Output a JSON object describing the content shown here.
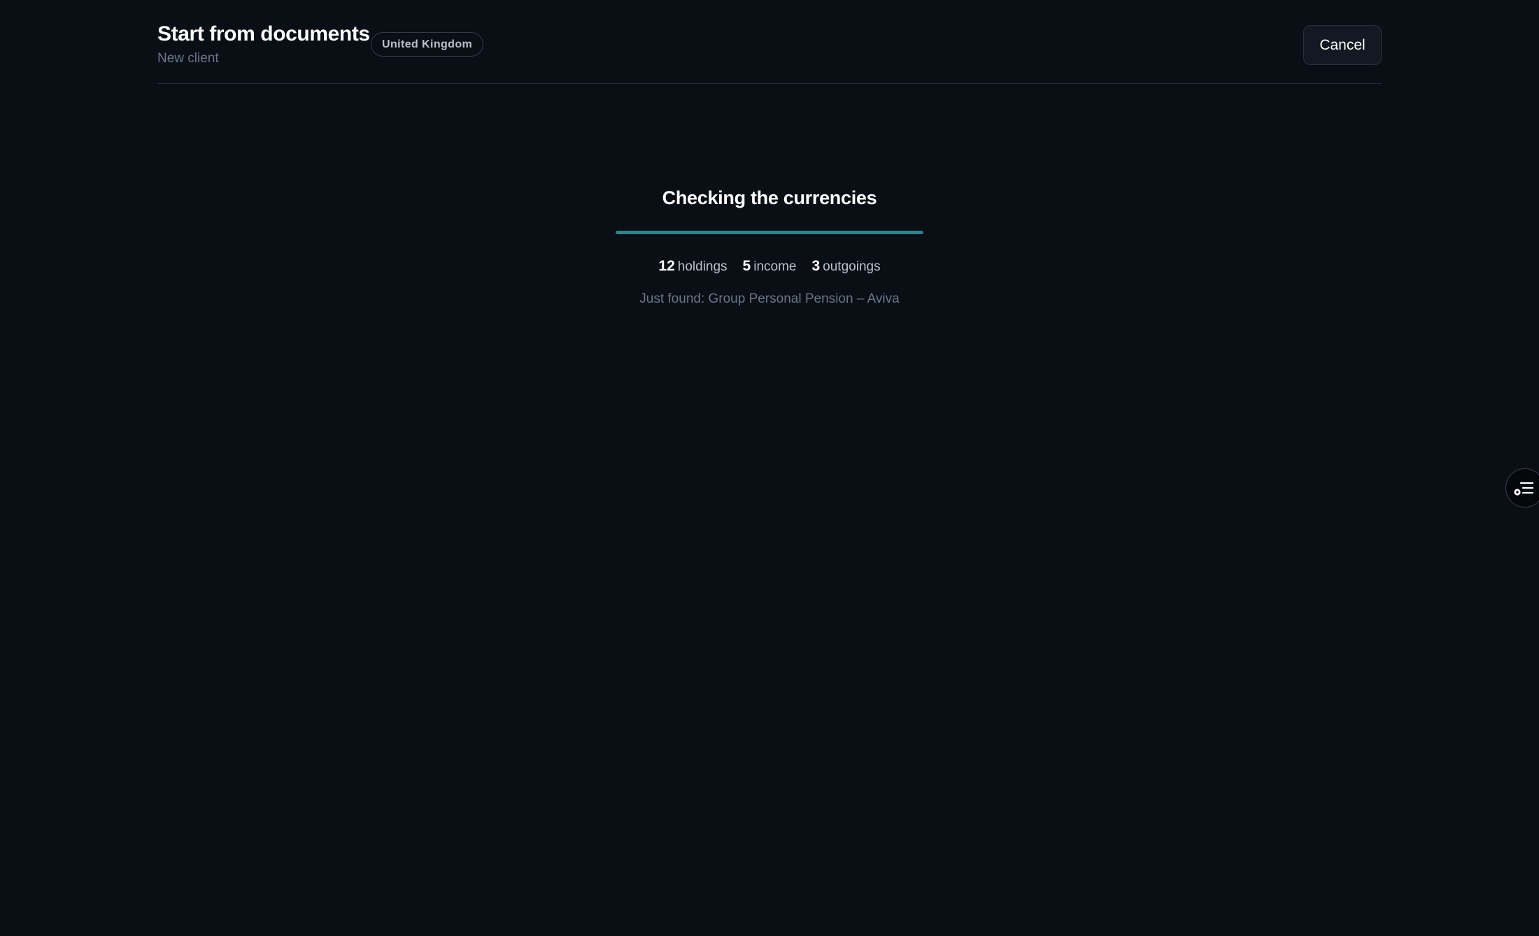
{
  "header": {
    "title": "Start from documents",
    "subtitle": "New client",
    "country_badge": "United Kingdom",
    "cancel_label": "Cancel"
  },
  "progress": {
    "status_title": "Checking the currencies",
    "fraction_complete": 1.0,
    "bar_color": "#2e8488",
    "counts": [
      {
        "value": "12",
        "label": "holdings"
      },
      {
        "value": "5",
        "label": "income"
      },
      {
        "value": "3",
        "label": "outgoings"
      }
    ],
    "just_found": "Just found: Group Personal Pension – Aviva"
  },
  "side_button": {
    "icon": "list-settings-icon"
  },
  "colors": {
    "background": "#0a0e15",
    "accent": "#2e8488",
    "muted_text": "#6b7788"
  }
}
